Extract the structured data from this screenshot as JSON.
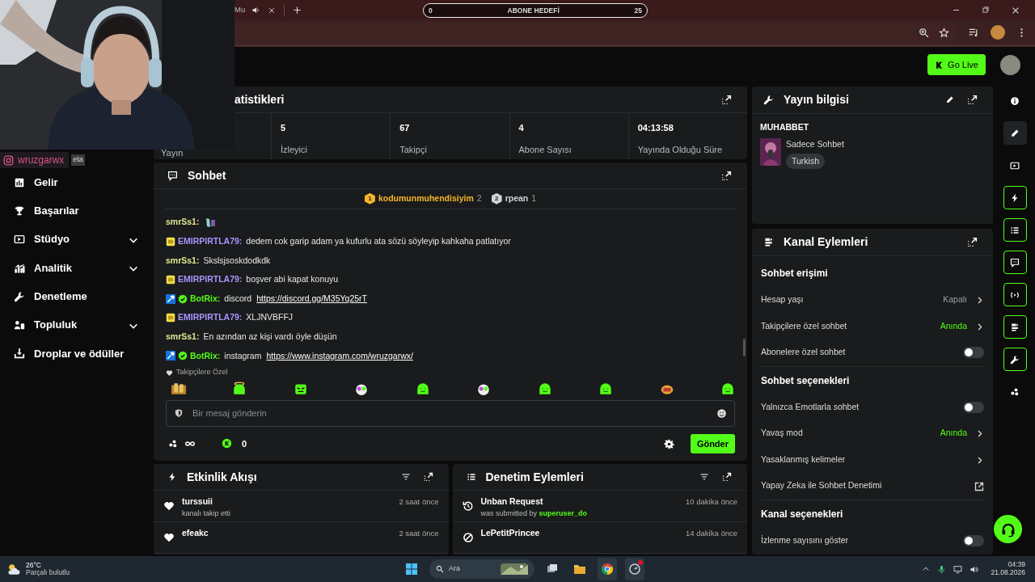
{
  "browser": {
    "tab_fragment": "Mu",
    "stream_goal": {
      "start": "0",
      "label": "ABONE HEDEFİ",
      "end": "25"
    }
  },
  "social_overlay": {
    "handle": "wruzgarwx",
    "fragment": "eta"
  },
  "header": {
    "go_live": "Go Live"
  },
  "sidebar": {
    "items": [
      {
        "label": "Gelir",
        "kind": "link"
      },
      {
        "label": "Başarılar",
        "kind": "link"
      },
      {
        "label": "Stüdyo",
        "kind": "group"
      },
      {
        "label": "Analitik",
        "kind": "group"
      },
      {
        "label": "Denetleme",
        "kind": "link"
      },
      {
        "label": "Topluluk",
        "kind": "group"
      },
      {
        "label": "Droplar ve ödüller",
        "kind": "link"
      }
    ]
  },
  "stats": {
    "title": "atistikleri",
    "items": [
      {
        "label": "Yayın"
      },
      {
        "value": "5",
        "label": "İzleyici"
      },
      {
        "value": "67",
        "label": "Takipçi"
      },
      {
        "value": "4",
        "label": "Abone Sayısı"
      },
      {
        "value": "04:13:58",
        "label": "Yayında Olduğu Süre"
      }
    ]
  },
  "chat": {
    "title": "Sohbet",
    "leaders": [
      {
        "rank": "1",
        "name": "kodumunmuhendisiyim",
        "count": "2",
        "color": "#f5b72a"
      },
      {
        "rank": "2",
        "name": "rpean",
        "count": "1",
        "color": "#cfd2d6"
      }
    ],
    "messages": [
      {
        "user": "smrSs1:",
        "color": "#dfe68f",
        "emote": true
      },
      {
        "user": "EMIRPIRTLA79:",
        "color": "#a995ff",
        "badges": [
          {
            "kind": "sub"
          }
        ],
        "text": "dedem cok garip adam ya kufurlu ata sözü söyleyip kahkaha patlatıyor"
      },
      {
        "user": "smrSs1:",
        "color": "#dfe68f",
        "text": "Skslsjsoskdodkdk"
      },
      {
        "user": "EMIRPIRTLA79:",
        "color": "#a995ff",
        "badges": [
          {
            "kind": "sub"
          }
        ],
        "text": "boşver abi kapat konuyu"
      },
      {
        "user": "BotRix:",
        "color": "#53fc18",
        "badges": [
          {
            "kind": "mod"
          },
          {
            "kind": "verified"
          }
        ],
        "text": "discord",
        "link": "https://discord.gg/M35Yq25rT"
      },
      {
        "user": "EMIRPIRTLA79:",
        "color": "#a995ff",
        "badges": [
          {
            "kind": "sub"
          }
        ],
        "text": "XLJNVBFFJ"
      },
      {
        "user": "smrSs1:",
        "color": "#dfe68f",
        "text": "En azından az kişi vardı öyle düşün"
      },
      {
        "user": "BotRix:",
        "color": "#53fc18",
        "badges": [
          {
            "kind": "mod"
          },
          {
            "kind": "verified"
          }
        ],
        "text": "instagram",
        "link": "https://www.instagram.com/wruzgarwx/"
      }
    ],
    "emote_section": "Takipçilere Özel",
    "emotes": [
      {
        "kind": "gold"
      },
      {
        "kind": "halo"
      },
      {
        "kind": "square"
      },
      {
        "kind": "multi"
      },
      {
        "kind": "blob"
      },
      {
        "kind": "multi"
      },
      {
        "kind": "blob"
      },
      {
        "kind": "blob"
      },
      {
        "kind": "red"
      },
      {
        "kind": "blob"
      }
    ],
    "placeholder": "Bir mesaj gönderin",
    "points": "0",
    "send": "Gönder"
  },
  "events": {
    "title": "Etkinlik Akışı",
    "items": [
      {
        "user": "turssuii",
        "detail": "kanalı takip etti",
        "time": "2 saat önce"
      },
      {
        "user": "efeakc",
        "time": "2 saat önce"
      }
    ]
  },
  "moderation": {
    "title": "Denetim Eylemleri",
    "items": [
      {
        "kind": "unban",
        "title": "Unban Request",
        "detail": "was submitted by",
        "actor": "superuser_do",
        "time": "10 dakika önce"
      },
      {
        "kind": "ban",
        "title": "LePetitPrincee",
        "time": "14 dakika önce"
      }
    ]
  },
  "stream_info": {
    "title": "Yayın bilgisi",
    "category": "MUHABBET",
    "stream_title": "Sadece Sohbet",
    "tag": "Turkish"
  },
  "channel_actions": {
    "title": "Kanal Eylemleri",
    "sections": [
      {
        "title": "Sohbet erişimi",
        "rows": [
          {
            "kind": "link",
            "label": "Hesap yaşı",
            "value": "Kapalı",
            "highlighted": false
          },
          {
            "kind": "link",
            "label": "Takipçilere özel sohbet",
            "value": "Anında",
            "highlighted": true
          },
          {
            "kind": "toggle",
            "label": "Abonelere özel sohbet",
            "on": false
          }
        ]
      },
      {
        "title": "Sohbet seçenekleri",
        "rows": [
          {
            "kind": "toggle",
            "label": "Yalnızca Emotlarla sohbet",
            "on": false
          },
          {
            "kind": "link",
            "label": "Yavaş mod",
            "value": "Anında",
            "highlighted": true
          },
          {
            "kind": "link",
            "label": "Yasaklanmış kelimeler"
          },
          {
            "kind": "external",
            "label": "Yapay Zeka ile Sohbet Denetimi"
          }
        ]
      },
      {
        "title": "Kanal seçenekleri",
        "rows": [
          {
            "kind": "toggle",
            "label": "İzlenme sayısını göster",
            "on": false
          }
        ]
      }
    ]
  },
  "rail": {
    "items": [
      {
        "active": false,
        "highlighted": false
      },
      {
        "active": false,
        "highlighted": true
      },
      {
        "active": false,
        "highlighted": false
      },
      {
        "active": true,
        "highlighted": false
      },
      {
        "active": true,
        "highlighted": false
      },
      {
        "active": true,
        "highlighted": false
      },
      {
        "active": true,
        "highlighted": false
      },
      {
        "active": true,
        "highlighted": false
      },
      {
        "active": true,
        "highlighted": false
      },
      {
        "active": false,
        "highlighted": false
      }
    ]
  },
  "taskbar": {
    "weather": {
      "temp": "26°C",
      "desc": "Parçalı bulutlu"
    },
    "search": "Ara",
    "apps": [
      {
        "kind": "taskview",
        "running": false,
        "notification": false
      },
      {
        "kind": "folder",
        "running": false,
        "notification": false
      },
      {
        "kind": "browser",
        "running": true,
        "notification": false
      },
      {
        "kind": "app",
        "running": true,
        "notification": true
      }
    ],
    "time": "04:39",
    "date": "21.08.2026"
  }
}
